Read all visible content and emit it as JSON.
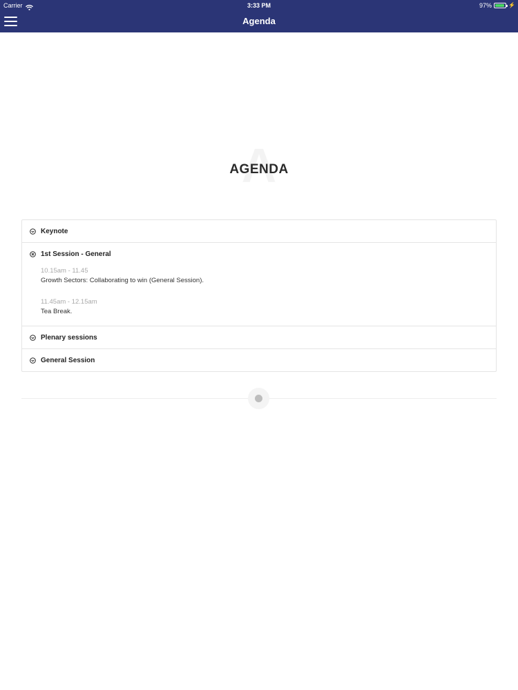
{
  "status_bar": {
    "carrier": "Carrier",
    "time": "3:33 PM",
    "battery": "97%",
    "battery_level": 0.97,
    "battery_color": "#4cd964"
  },
  "nav": {
    "title": "Agenda",
    "menu_icon": "hamburger-menu-icon",
    "background": "#2b3576"
  },
  "page": {
    "heading": "AGENDA",
    "watermark": "A"
  },
  "accordion": {
    "items": [
      {
        "title": "Keynote",
        "icon": "chevron-circle-down-icon",
        "expanded": false
      },
      {
        "title": "1st Session - General",
        "icon": "close-circle-icon",
        "expanded": true,
        "entries": [
          {
            "time": "10.15am - 11.45",
            "description": "Growth Sectors: Collaborating to win (General Session)."
          },
          {
            "time": "11.45am - 12.15am",
            "description": "Tea Break."
          }
        ]
      },
      {
        "title": "Plenary sessions",
        "icon": "chevron-circle-down-icon",
        "expanded": false
      },
      {
        "title": "General Session",
        "icon": "chevron-circle-down-icon",
        "expanded": false
      }
    ]
  }
}
